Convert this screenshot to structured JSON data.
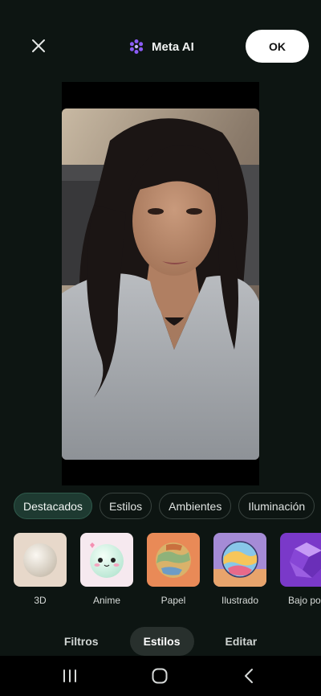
{
  "header": {
    "brand_label": "Meta AI",
    "ok_label": "OK",
    "accent": "#8b5cf6"
  },
  "categories": [
    {
      "label": "Destacados",
      "active": true
    },
    {
      "label": "Estilos",
      "active": false
    },
    {
      "label": "Ambientes",
      "active": false
    },
    {
      "label": "Iluminación",
      "active": false
    }
  ],
  "styles": [
    {
      "label": "3D",
      "icon": "white-sphere"
    },
    {
      "label": "Anime",
      "icon": "kawaii-sphere"
    },
    {
      "label": "Papel",
      "icon": "paper-sphere"
    },
    {
      "label": "Ilustrado",
      "icon": "illustrated-sphere"
    },
    {
      "label": "Bajo poli",
      "icon": "low-poly-sphere"
    }
  ],
  "tabs": [
    {
      "label": "Filtros",
      "active": false
    },
    {
      "label": "Estilos",
      "active": true
    },
    {
      "label": "Editar",
      "active": false
    }
  ],
  "system_nav": [
    "recent-apps-icon",
    "home-icon",
    "back-icon"
  ]
}
